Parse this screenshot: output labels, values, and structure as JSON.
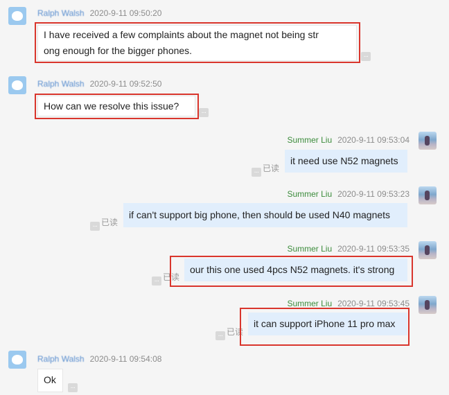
{
  "messages": [
    {
      "sender": "Ralph Walsh",
      "time": "2020-9-11 09:50:20",
      "text": [
        "I have received a few complaints about the magnet not being str",
        "ong enough for the bigger phones."
      ]
    },
    {
      "sender": "Ralph Walsh",
      "time": "2020-9-11 09:52:50",
      "text": [
        "How can we resolve this issue?"
      ]
    },
    {
      "sender": "Summer Liu",
      "time": "2020-9-11 09:53:04",
      "text": [
        "it need use N52 magnets"
      ],
      "read": "已读"
    },
    {
      "sender": "Summer Liu",
      "time": "2020-9-11 09:53:23",
      "text": [
        "if can't support big phone, then should be used N40 magnets"
      ],
      "read": "已读"
    },
    {
      "sender": "Summer Liu",
      "time": "2020-9-11 09:53:35",
      "text": [
        "our this one used 4pcs N52 magnets. it's strong"
      ],
      "read": "已读"
    },
    {
      "sender": "Summer Liu",
      "time": "2020-9-11 09:53:45",
      "text": [
        "it can support iPhone 11 pro max"
      ],
      "read": "已读"
    },
    {
      "sender": "Ralph Walsh",
      "time": "2020-9-11 09:54:08",
      "text": [
        "Ok"
      ]
    }
  ],
  "icons": {
    "more": "ellipsis-icon",
    "avatar_left": "default-avatar-icon",
    "avatar_right": "profile-photo"
  },
  "colors": {
    "outgoing_bubble": "#e1eefc",
    "incoming_bubble": "#ffffff",
    "highlight": "#d9352c",
    "sender_right": "#3c8c3c",
    "sender_left": "#5b8fcf"
  }
}
